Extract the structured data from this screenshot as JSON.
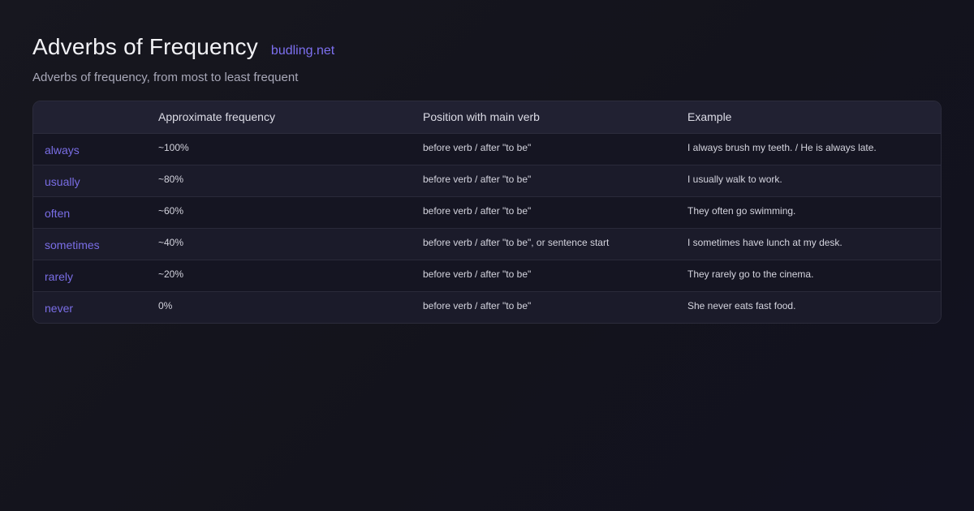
{
  "header": {
    "title": "Adverbs of Frequency",
    "site": "budling.net",
    "subtitle": "Adverbs of frequency, from most to least frequent"
  },
  "table": {
    "columns": [
      "",
      "Approximate frequency",
      "Position with main verb",
      "Example"
    ],
    "rows": [
      {
        "adverb": "always",
        "frequency": "~100%",
        "position": "before verb / after \"to be\"",
        "example": "I always brush my teeth. / He is always late."
      },
      {
        "adverb": "usually",
        "frequency": "~80%",
        "position": "before verb / after \"to be\"",
        "example": "I usually walk to work."
      },
      {
        "adverb": "often",
        "frequency": "~60%",
        "position": "before verb / after \"to be\"",
        "example": "They often go swimming."
      },
      {
        "adverb": "sometimes",
        "frequency": "~40%",
        "position": "before verb / after \"to be\", or sentence start",
        "example": "I sometimes have lunch at my desk."
      },
      {
        "adverb": "rarely",
        "frequency": "~20%",
        "position": "before verb / after \"to be\"",
        "example": "They rarely go to the cinema."
      },
      {
        "adverb": "never",
        "frequency": "0%",
        "position": "before verb / after \"to be\"",
        "example": "She never eats fast food."
      }
    ]
  },
  "colors": {
    "accent": "#7d70f0",
    "background": "#15151f"
  }
}
